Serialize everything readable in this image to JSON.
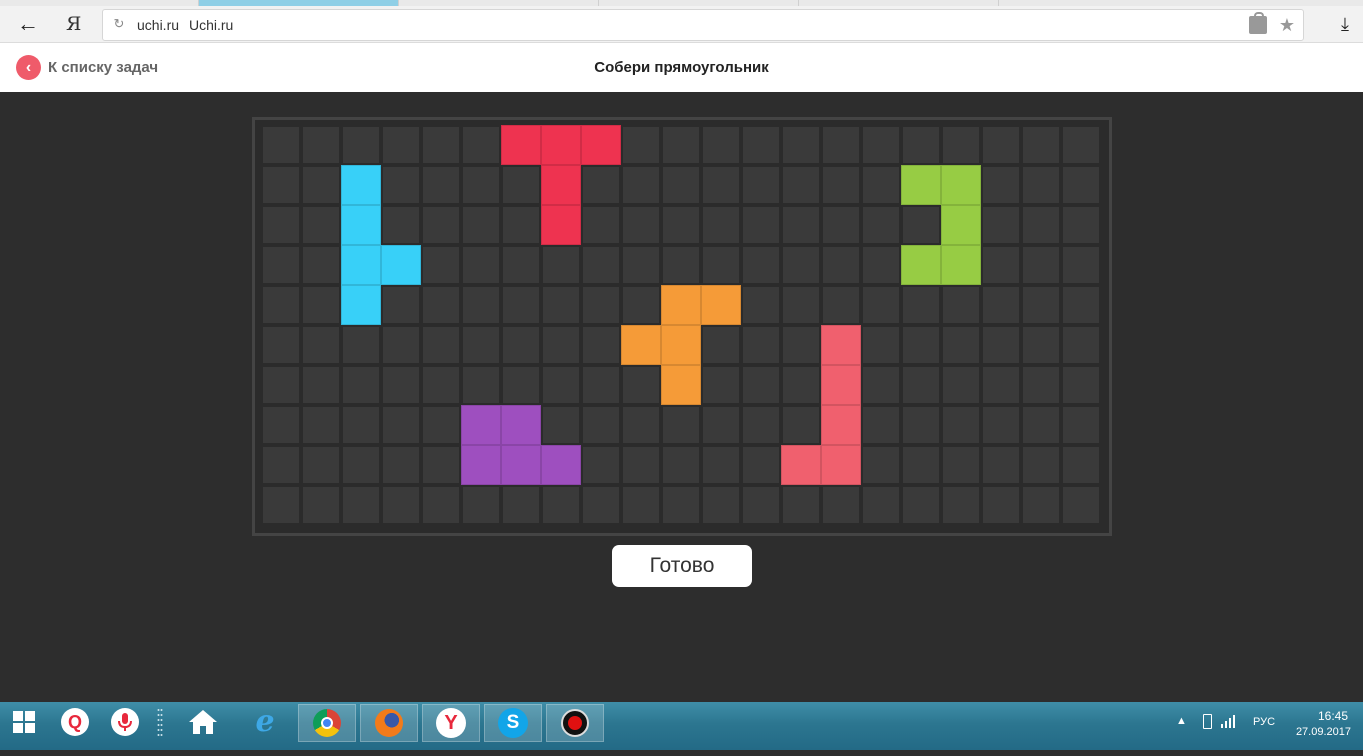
{
  "browser": {
    "url_domain": "uchi.ru",
    "url_title": "Uchi.ru",
    "ya_logo": "Я"
  },
  "header": {
    "back_label": "К списку задач",
    "title": "Собери прямоугольник"
  },
  "board": {
    "cols": 21,
    "rows": 10,
    "pieces": [
      {
        "name": "red-t-piece",
        "color": "#ee3350",
        "cells": [
          [
            6,
            0
          ],
          [
            7,
            0
          ],
          [
            8,
            0
          ],
          [
            7,
            1
          ],
          [
            7,
            2
          ]
        ]
      },
      {
        "name": "blue-l-piece",
        "color": "#38d0f8",
        "cells": [
          [
            2,
            1
          ],
          [
            2,
            2
          ],
          [
            2,
            3
          ],
          [
            3,
            3
          ],
          [
            2,
            4
          ]
        ]
      },
      {
        "name": "green-piece",
        "color": "#97cc44",
        "cells": [
          [
            16,
            1
          ],
          [
            17,
            1
          ],
          [
            17,
            2
          ],
          [
            16,
            3
          ],
          [
            17,
            3
          ]
        ]
      },
      {
        "name": "orange-piece",
        "color": "#f59b38",
        "cells": [
          [
            10,
            4
          ],
          [
            11,
            4
          ],
          [
            9,
            5
          ],
          [
            10,
            5
          ],
          [
            10,
            6
          ]
        ]
      },
      {
        "name": "pink-j-piece",
        "color": "#f0606e",
        "cells": [
          [
            14,
            5
          ],
          [
            14,
            6
          ],
          [
            14,
            7
          ],
          [
            13,
            8
          ],
          [
            14,
            8
          ]
        ]
      },
      {
        "name": "purple-piece",
        "color": "#9e4fbf",
        "cells": [
          [
            5,
            7
          ],
          [
            6,
            7
          ],
          [
            5,
            8
          ],
          [
            6,
            8
          ],
          [
            7,
            8
          ]
        ]
      }
    ]
  },
  "done_button": {
    "label": "Готово"
  },
  "taskbar": {
    "language": "РУС",
    "time": "16:45",
    "date": "27.09.2017",
    "apps": [
      "search-icon",
      "microphone-icon",
      "home-icon",
      "internet-explorer-icon",
      "chrome-icon",
      "firefox-icon",
      "yandex-browser-icon",
      "skype-icon",
      "record-icon"
    ]
  }
}
